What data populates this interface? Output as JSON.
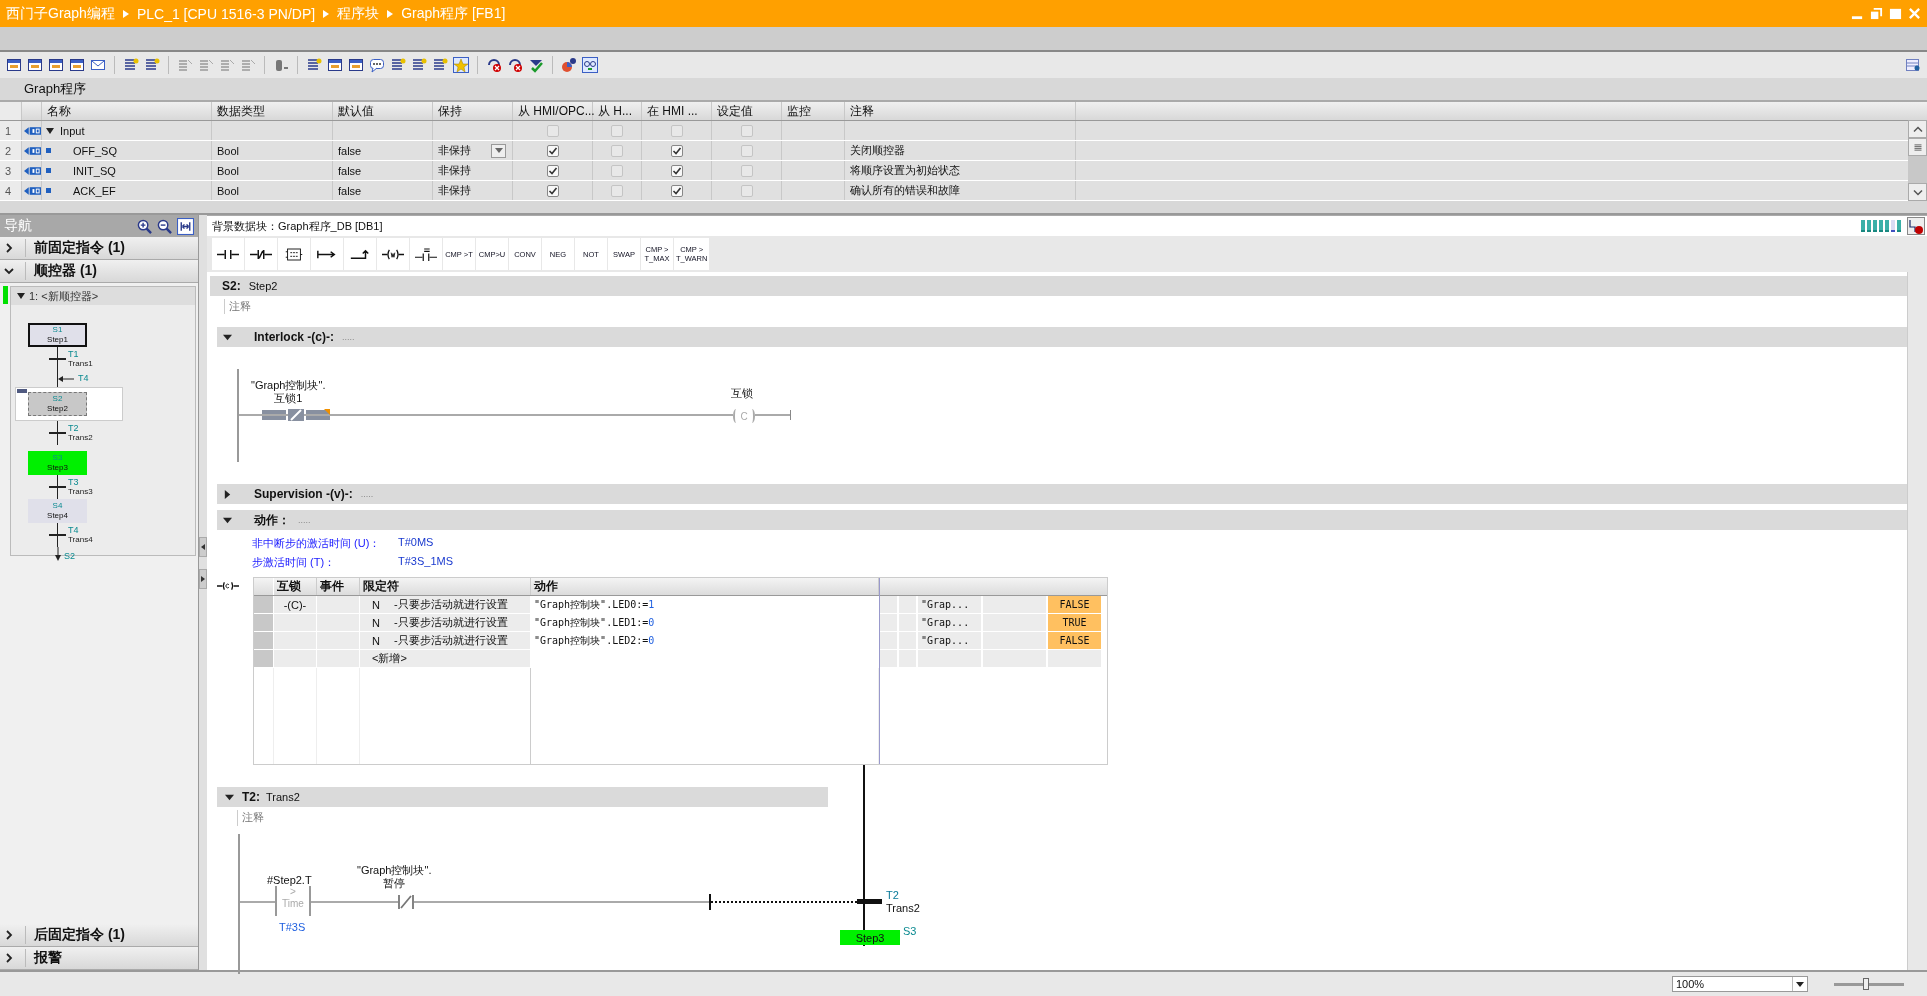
{
  "title_bar": {
    "breadcrumb": [
      "西门子Graph编程",
      "PLC_1 [CPU 1516-3 PN/DP]",
      "程序块",
      "Graph程序 [FB1]"
    ]
  },
  "interface": {
    "title": "Graph程序",
    "columns": [
      "名称",
      "数据类型",
      "默认值",
      "保持",
      "从 HMI/OPC...",
      "从 H...",
      "在 HMI ...",
      "设定值",
      "监控",
      "注释"
    ],
    "rows": [
      {
        "index": "1",
        "kind": "section",
        "name": "Input",
        "expanded": true,
        "editing": false,
        "checks": [
          false,
          false,
          false,
          false
        ]
      },
      {
        "index": "2",
        "kind": "member",
        "name": "OFF_SQ",
        "data_type": "Bool",
        "default": "false",
        "retain": "非保持",
        "editing": true,
        "checks": [
          true,
          false,
          true,
          false
        ],
        "comment": "关闭顺控器"
      },
      {
        "index": "3",
        "kind": "member",
        "name": "INIT_SQ",
        "data_type": "Bool",
        "default": "false",
        "retain": "非保持",
        "editing": false,
        "checks": [
          true,
          false,
          true,
          false
        ],
        "comment": "将顺序设置为初始状态"
      },
      {
        "index": "4",
        "kind": "member",
        "name": "ACK_EF",
        "data_type": "Bool",
        "default": "false",
        "retain": "非保持",
        "editing": false,
        "checks": [
          true,
          false,
          true,
          false
        ],
        "comment": "确认所有的错误和故障"
      }
    ]
  },
  "navigation": {
    "title": "导航",
    "sections_top": [
      {
        "label": "前固定指令 (1)",
        "expanded": false
      },
      {
        "label": "顺控器 (1)",
        "expanded": true
      }
    ],
    "sequence": {
      "title": "1: <新顺控器>",
      "expanded": true,
      "active": true,
      "elements": [
        {
          "kind": "step",
          "number": "S1",
          "name": "Step1",
          "initial": true,
          "active": false,
          "selected": false
        },
        {
          "kind": "transition",
          "number": "T1",
          "name": "Trans1"
        },
        {
          "kind": "jump_in",
          "target": "T4"
        },
        {
          "kind": "step",
          "number": "S2",
          "name": "Step2",
          "initial": false,
          "active": false,
          "selected": true
        },
        {
          "kind": "transition",
          "number": "T2",
          "name": "Trans2"
        },
        {
          "kind": "step",
          "number": "S3",
          "name": "Step3",
          "initial": false,
          "active": true,
          "selected": false
        },
        {
          "kind": "transition",
          "number": "T3",
          "name": "Trans3"
        },
        {
          "kind": "step",
          "number": "S4",
          "name": "Step4",
          "initial": false,
          "active": false,
          "selected": false
        },
        {
          "kind": "transition",
          "number": "T4",
          "name": "Trans4"
        },
        {
          "kind": "jump",
          "target": "S2"
        }
      ]
    },
    "sections_bottom": [
      {
        "label": "后固定指令 (1)",
        "expanded": false
      },
      {
        "label": "报警",
        "expanded": false
      }
    ]
  },
  "editor": {
    "instance_db": "背景数据块：Graph程序_DB [DB1]",
    "instructions": [
      {
        "lines": [
          "CMP >T"
        ]
      },
      {
        "lines": [
          "CMP>U"
        ]
      },
      {
        "lines": [
          "CONV"
        ]
      },
      {
        "lines": [
          "NEG"
        ]
      },
      {
        "lines": [
          "NOT"
        ]
      },
      {
        "lines": [
          "SWAP"
        ]
      },
      {
        "lines": [
          "CMP >",
          "T_MAX"
        ]
      },
      {
        "lines": [
          "CMP >",
          "T_WARN"
        ]
      }
    ],
    "step": {
      "number": "S2:",
      "name": "Step2",
      "comment": "注释"
    },
    "interlock": {
      "title": "Interlock -(c)-:",
      "dots": ".....",
      "expanded": true,
      "operand_lines": [
        "\"Graph控制块\".",
        "互锁1"
      ],
      "coil_label": "互锁",
      "coil": "C"
    },
    "supervision": {
      "title": "Supervision -(v)-:",
      "dots": ".....",
      "expanded": false
    },
    "actions": {
      "title": "动作：",
      "dots": ".....",
      "expanded": true,
      "params": [
        {
          "label": "非中断步的激活时间 (U)：",
          "value": "T#0MS"
        },
        {
          "label": "步激活时间 (T)：",
          "value": "T#3S_1MS"
        }
      ],
      "table": {
        "columns": [
          "互锁",
          "事件",
          "限定符",
          "动作"
        ],
        "rows": [
          {
            "interlock": "-(C)-",
            "qualifier": "N",
            "qualifier_text": "-只要步活动就进行设置",
            "action": "\"Graph控制块\".LED0:=",
            "action_value": "1",
            "monitor_operand": "\"Grap...",
            "monitor_value": "FALSE"
          },
          {
            "qualifier": "N",
            "qualifier_text": "-只要步活动就进行设置",
            "action": "\"Graph控制块\".LED1:=",
            "action_value": "0",
            "monitor_operand": "\"Grap...",
            "monitor_value": "TRUE"
          },
          {
            "qualifier": "N",
            "qualifier_text": "-只要步活动就进行设置",
            "action": "\"Graph控制块\".LED2:=",
            "action_value": "0",
            "monitor_operand": "\"Grap...",
            "monitor_value": "FALSE"
          }
        ],
        "add_row": "<新增>"
      }
    },
    "transition": {
      "number": "T2:",
      "name": "Trans2",
      "comment": "注释",
      "compare": {
        "operand": "#Step2.T",
        "operator": ">",
        "label": "Time",
        "value": "T#3S"
      },
      "contact_lines": [
        "\"Graph控制块\".",
        "暂停"
      ],
      "target": {
        "number": "T2",
        "name": "Trans2"
      },
      "next_step": {
        "name": "Step3",
        "number": "S3",
        "active": true
      }
    }
  },
  "status_bar": {
    "zoom": "100%",
    "zoom_slider": {
      "level": 0.45
    }
  }
}
